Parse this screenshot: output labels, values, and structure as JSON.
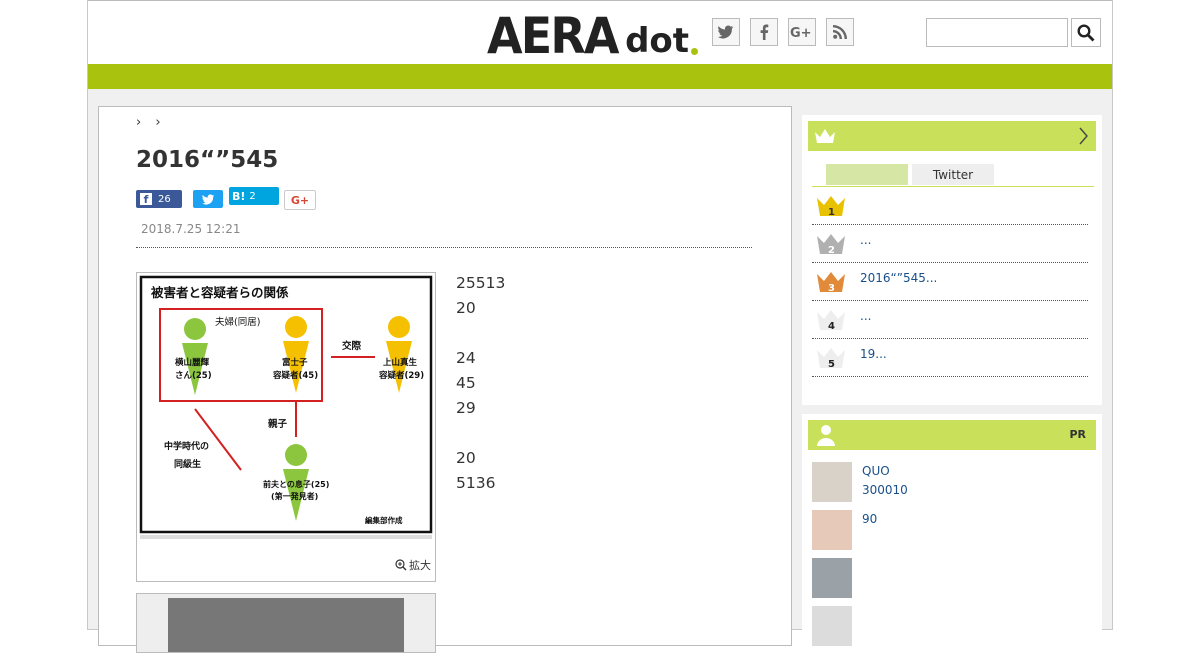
{
  "colors": {
    "brand_green": "#a8c20e",
    "side_green": "#c9e05a",
    "link_blue": "#1a4f8a",
    "gold": "#e8c200",
    "silver": "#b0b0b0",
    "bronze": "#e08a3a",
    "fb_blue": "#3b5998",
    "tw_blue": "#1da1f2",
    "hatena_blue": "#00a4de"
  },
  "header": {
    "logo_main": "AERA",
    "logo_sub": "dot",
    "social_icons": [
      "twitter-icon",
      "facebook-icon",
      "google-plus-icon",
      "rss-icon"
    ],
    "search": {
      "value": "",
      "placeholder": ""
    }
  },
  "article": {
    "breadcrumb_sep1": "›",
    "breadcrumb_sep2": "›",
    "title": "2016“”545",
    "share": {
      "facebook_count": "26",
      "hatena_label": "B!",
      "hatena_count": "2",
      "google_label": "G+"
    },
    "date": "2018.7.25 12:21",
    "figure": {
      "heading": "被害者と容疑者らの関係",
      "couple_label": "夫婦(同居)",
      "victim_label": "横山麗輝\nさん(25)",
      "fujiko_label": "富士子\n容疑者(45)",
      "relation_label": "交際",
      "kamiyama_label": "上山真生\n容疑者(29)",
      "parent_label": "親子",
      "school_label": "中学時代の\n同級生",
      "son_label": "前夫との息子(25)\n(第一発見者)",
      "credit": "編集部作成",
      "zoom_label": "拡大"
    },
    "paragraphs": [
      "25513",
      "20",
      "",
      "24",
      "45",
      "29",
      "20",
      "5136",
      ""
    ]
  },
  "sidebar": {
    "ranking": {
      "tabs": [
        "",
        "Twitter"
      ],
      "items": [
        {
          "rank": "1",
          "text": ""
        },
        {
          "rank": "2",
          "text": "..."
        },
        {
          "rank": "3",
          "text": "2016“”545..."
        },
        {
          "rank": "4",
          "text": "..."
        },
        {
          "rank": "5",
          "text": "19..."
        }
      ]
    },
    "pr": {
      "label": "PR",
      "items": [
        {
          "line1": "QUO",
          "line2": "300010"
        },
        {
          "line1": "90",
          "line2": ""
        },
        {
          "line1": "",
          "line2": ""
        },
        {
          "line1": "",
          "line2": ""
        }
      ]
    }
  }
}
